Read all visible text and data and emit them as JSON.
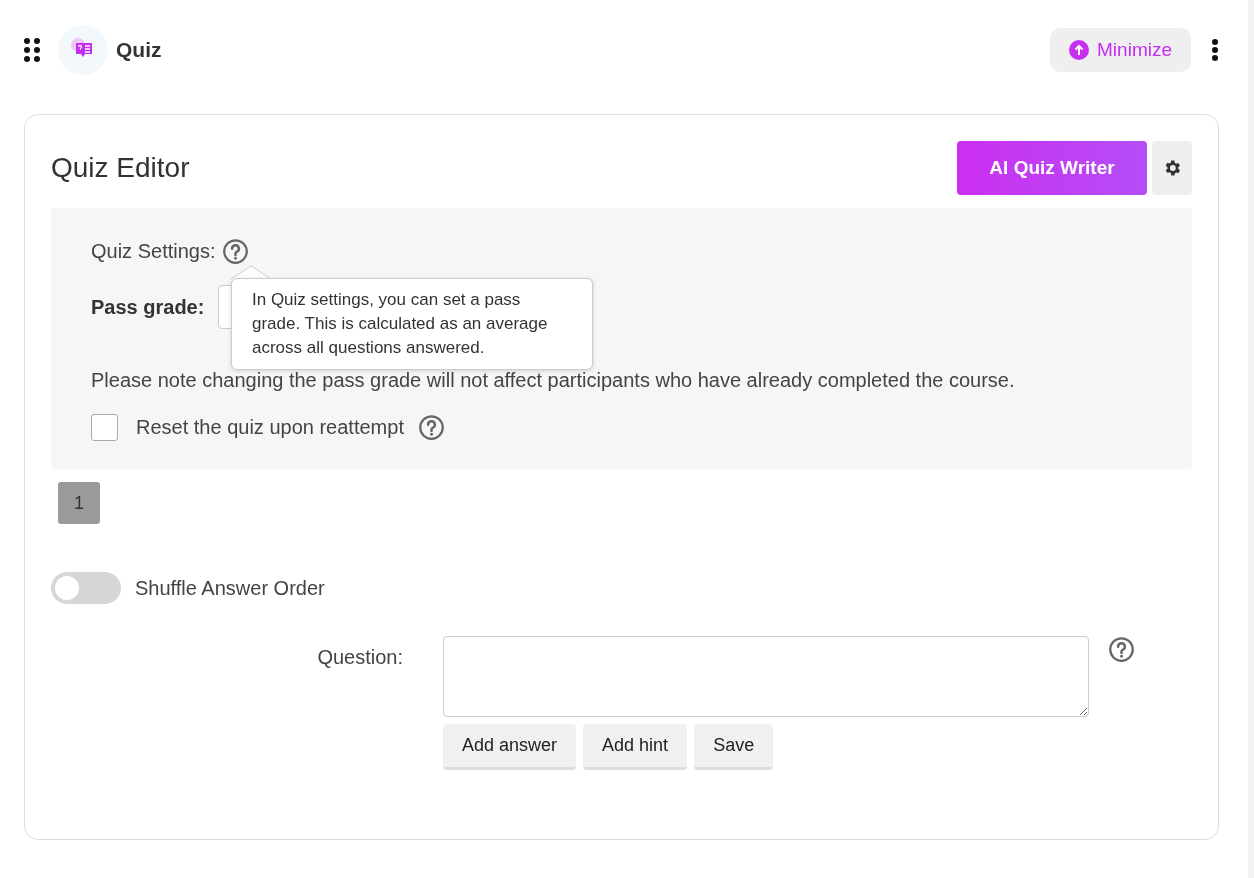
{
  "header": {
    "title": "Quiz",
    "minimize_label": "Minimize"
  },
  "editor": {
    "title": "Quiz Editor",
    "ai_button": "AI Quiz Writer"
  },
  "settings": {
    "label": "Quiz Settings:",
    "tooltip": "In Quiz settings, you can set a pass grade. This is calculated as an average across all questions answered.",
    "tooltip_open": true,
    "pass_grade_label": "Pass grade:",
    "note": "Please note changing the pass grade will not affect participants who have already completed the course.",
    "reset": {
      "label": "Reset the quiz upon reattempt",
      "checked": false
    }
  },
  "pages": [
    {
      "label": "1",
      "selected": true
    }
  ],
  "shuffle": {
    "label": "Shuffle Answer Order",
    "on": false
  },
  "question": {
    "label": "Question:",
    "buttons": [
      "Add answer",
      "Add hint",
      "Save"
    ]
  }
}
